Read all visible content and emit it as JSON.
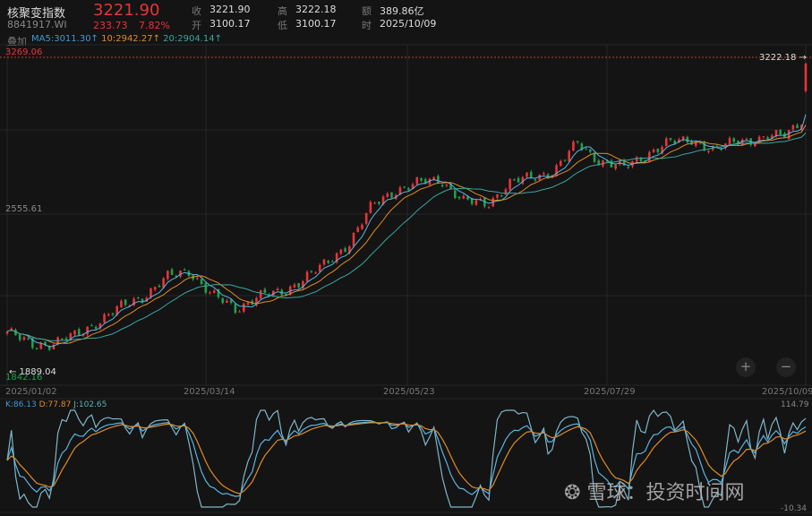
{
  "header": {
    "name": "核聚变指数",
    "code": "8841917.WI",
    "price": "3221.90",
    "change": "233.73",
    "change_pct": "7.82%",
    "fields": [
      {
        "label": "收",
        "value": "3221.90"
      },
      {
        "label": "高",
        "value": "3222.18"
      },
      {
        "label": "额",
        "value": "389.86亿"
      },
      {
        "label": "开",
        "value": "3100.17"
      },
      {
        "label": "低",
        "value": "3100.17"
      },
      {
        "label": "时",
        "value": "2025/10/09"
      }
    ],
    "overlay_label": "叠加",
    "ma5": "MA5:3011.30↑",
    "ma10": "10:2942.27↑",
    "ma20": "20:2904.14↑"
  },
  "colors": {
    "up": "#e8343a",
    "down": "#1fa04f",
    "ma5": "#5ab4e0",
    "ma10": "#e08a2a",
    "ma20": "#3aa6a0",
    "k": "#5ab4e0",
    "d": "#e08a2a",
    "j": "#7fb6c8"
  },
  "chart_data": {
    "type": "candlestick",
    "x_ticks": [
      "2025/01/02",
      "2025/03/14",
      "2025/05/23",
      "2025/07/29",
      "2025/10/09"
    ],
    "ylim": [
      1842.16,
      3269.06
    ],
    "max_label": "3269.06",
    "min_label": "1842.16",
    "mid_label": "2555.61",
    "last_high_label": "3222.18 →",
    "low_marker_label": "← 1889.04",
    "close": [
      2040,
      1980,
      1988,
      2020,
      2087,
      2146,
      2198,
      2277,
      2308,
      2198,
      2138,
      2198,
      2206,
      2277,
      2336,
      2435,
      2593,
      2664,
      2692,
      2712,
      2613,
      2601,
      2692,
      2720,
      2751,
      2870,
      2791,
      2759,
      2822,
      2870,
      2890,
      2830,
      2890,
      2882,
      2909,
      2988,
      3221.9
    ],
    "kdj": {
      "labels": {
        "k": "K:86.13",
        "d": "D:77.87",
        "j": "J:102.65"
      },
      "ylim": [
        -10.34,
        114.79
      ],
      "max_label": "114.79",
      "min_label": "-10.34"
    }
  },
  "controls": {
    "zoom_in": "+",
    "zoom_out": "−"
  },
  "watermark": "雪球：投资时间网"
}
